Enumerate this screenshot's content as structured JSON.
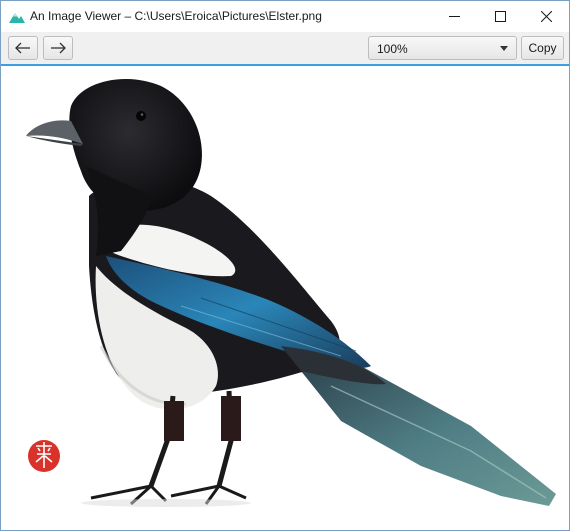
{
  "window": {
    "title": "An Image Viewer – C:\\Users\\Eroica\\Pictures\\Elster.png",
    "app_icon": "mountain-image-icon",
    "controls": {
      "minimize": "minimize-icon",
      "maximize": "maximize-icon",
      "close": "close-icon"
    }
  },
  "toolbar": {
    "back_icon": "arrow-left-icon",
    "forward_icon": "arrow-right-icon",
    "zoom": {
      "selected": "100%"
    },
    "copy_label": "Copy"
  },
  "image": {
    "subject": "magpie-illustration",
    "seal_icon": "red-seal-stamp"
  },
  "colors": {
    "accent": "#3c9fe0",
    "app_icon": "#2bb5a8",
    "seal": "#d8322a"
  }
}
